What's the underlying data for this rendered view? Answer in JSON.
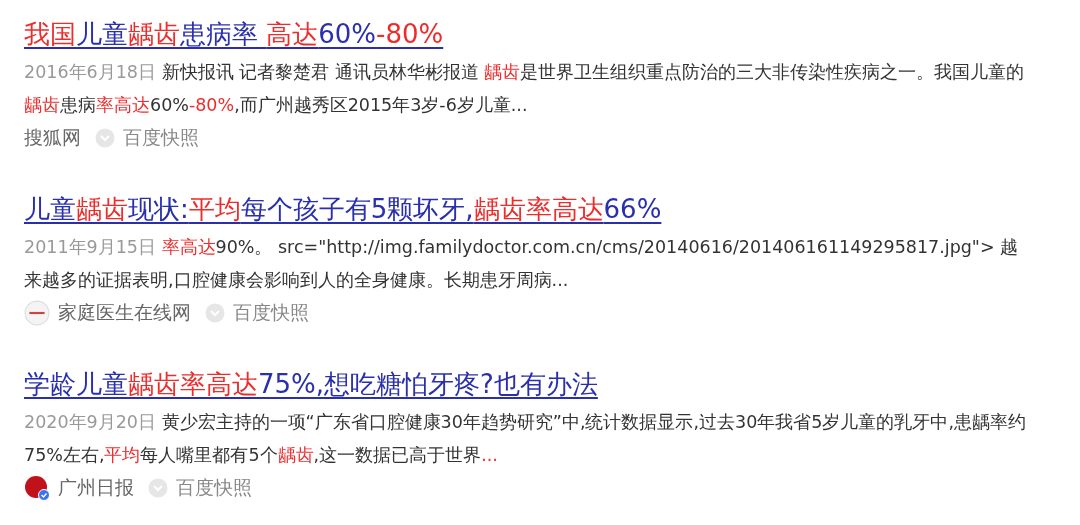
{
  "results": [
    {
      "title": [
        {
          "text": "我国",
          "highlight": true
        },
        {
          "text": "儿童",
          "highlight": false
        },
        {
          "text": "龋齿",
          "highlight": true
        },
        {
          "text": "患病率 ",
          "highlight": false
        },
        {
          "text": "高达",
          "highlight": true
        },
        {
          "text": "60%",
          "highlight": false
        },
        {
          "text": "-80%",
          "highlight": true
        }
      ],
      "date": "2016年6月18日",
      "snippet": [
        {
          "text": "新快报讯 记者黎楚君 通讯员林华彬报道 ",
          "highlight": false
        },
        {
          "text": "龋齿",
          "highlight": true
        },
        {
          "text": "是世界卫生组织重点防治的三大非传染性疾病之一。我国儿童的",
          "highlight": false
        },
        {
          "text": "龋齿",
          "highlight": true
        },
        {
          "text": "患病",
          "highlight": false
        },
        {
          "text": "率高达",
          "highlight": true
        },
        {
          "text": "60%",
          "highlight": false
        },
        {
          "text": "-80%",
          "highlight": true
        },
        {
          "text": ",而广州越秀区2015年3岁-6岁儿童...",
          "highlight": false
        }
      ],
      "source": {
        "name": "搜狐网"
      },
      "snapshot": "百度快照"
    },
    {
      "title": [
        {
          "text": "儿童",
          "highlight": false
        },
        {
          "text": "龋齿",
          "highlight": true
        },
        {
          "text": "现状:",
          "highlight": false
        },
        {
          "text": "平均",
          "highlight": true
        },
        {
          "text": "每个孩子有5颗坏牙,",
          "highlight": false
        },
        {
          "text": "龋齿率高达",
          "highlight": true
        },
        {
          "text": "66%",
          "highlight": false
        }
      ],
      "date": "2011年9月15日",
      "snippet": [
        {
          "text": "率高达",
          "highlight": true
        },
        {
          "text": "90%。  src=\"http://img.familydoctor.com.cn/cms/20140616/201406161149295817.jpg\"> 越来越多的证据表明,口腔健康会影响到人的全身健康。长期患牙周病...",
          "highlight": false
        }
      ],
      "source": {
        "name": "家庭医生在线网",
        "kind": "stripe"
      },
      "snapshot": "百度快照"
    },
    {
      "title": [
        {
          "text": "学龄儿童",
          "highlight": false
        },
        {
          "text": "龋齿率高达",
          "highlight": true
        },
        {
          "text": "75%,想吃糖怕牙疼?也有办法",
          "highlight": false
        }
      ],
      "date": "2020年9月20日",
      "snippet": [
        {
          "text": "黄少宏主持的一项“广东省口腔健康30年趋势研究”中,统计数据显示,过去30年我省5岁儿童的乳牙中,患龋率约75%左右,",
          "highlight": false
        },
        {
          "text": "平均",
          "highlight": true
        },
        {
          "text": "每人嘴里都有5个",
          "highlight": false
        },
        {
          "text": "龋齿",
          "highlight": true
        },
        {
          "text": ",这一数据已高于世界",
          "highlight": false
        },
        {
          "text": "...",
          "highlight": true
        }
      ],
      "source": {
        "name": "广州日报",
        "kind": "seal"
      },
      "snapshot": "百度快照"
    }
  ]
}
